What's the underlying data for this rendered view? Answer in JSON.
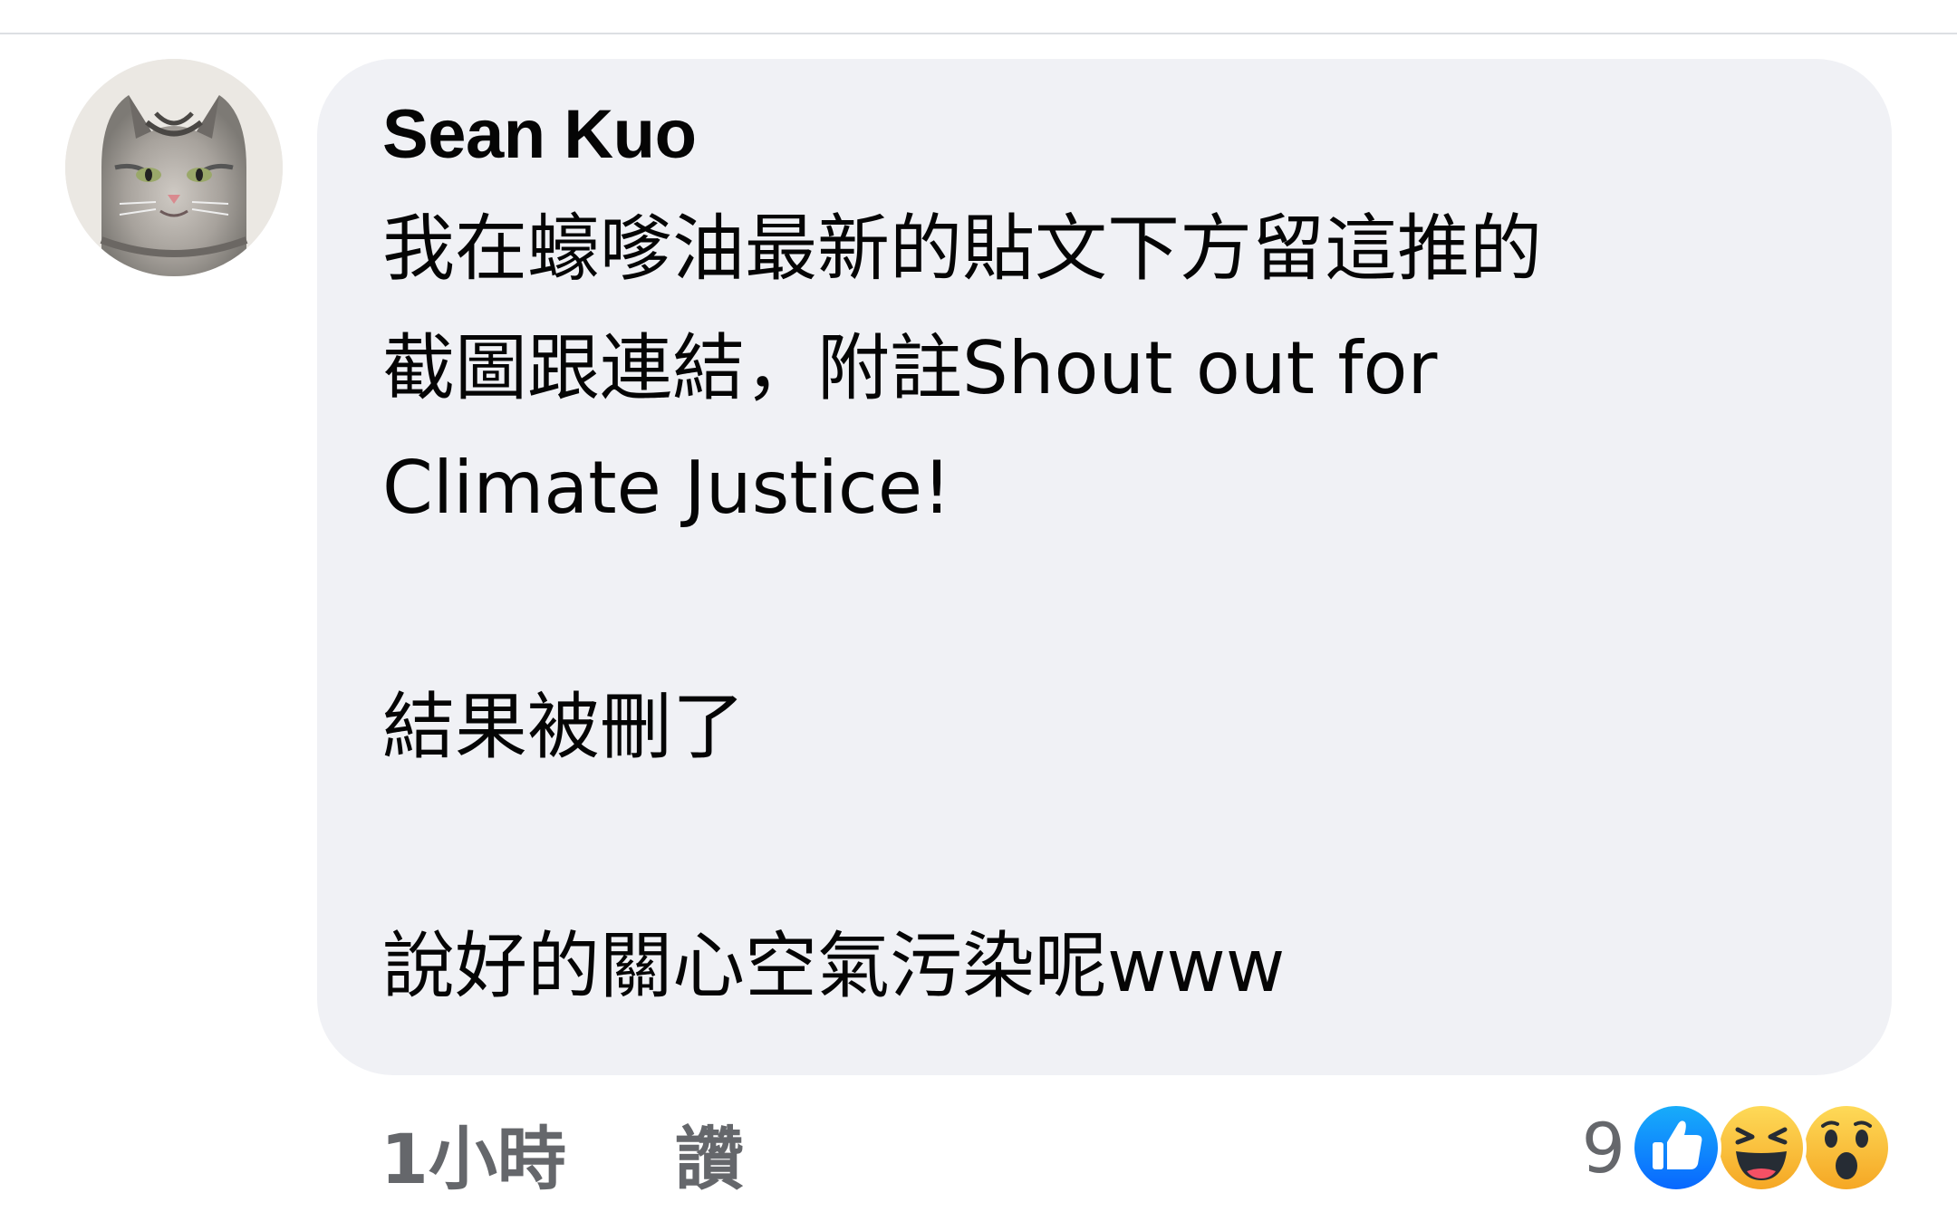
{
  "comment": {
    "author": "Sean Kuo",
    "lines": [
      "我在蠔嗲油最新的貼文下方留這推的",
      "截圖跟連結，附註Shout out for",
      "Climate Justice!",
      "",
      "結果被刪了",
      "",
      "說好的關心空氣污染呢www"
    ],
    "time": "1小時",
    "like_label": "讚",
    "reaction_count": "9",
    "reactions": [
      "like-icon",
      "haha-icon",
      "wow-icon"
    ]
  },
  "colors": {
    "bubble": "#f0f1f5",
    "text": "#050505",
    "meta": "#65676b",
    "like_blue": "#1877f2",
    "emoji_yellow": "#f7b125"
  }
}
